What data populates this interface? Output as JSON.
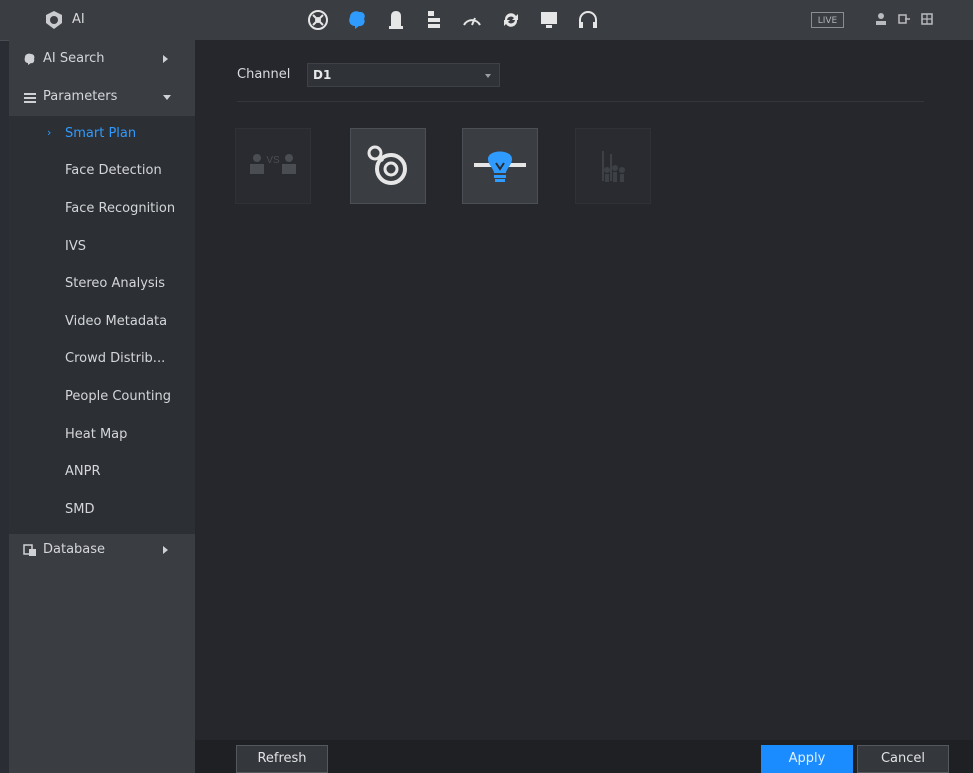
{
  "app": {
    "title": "AI"
  },
  "topbar": {
    "icons": [
      "ptz-icon",
      "ai-brain-icon",
      "alarm-bell-icon",
      "storage-icon",
      "performance-gauge-icon",
      "refresh-sync-icon",
      "monitor-icon",
      "headset-icon"
    ],
    "live_label": "LIVE",
    "right_icons": [
      "user-icon",
      "logout-icon",
      "grid-icon"
    ]
  },
  "sidebar": {
    "ai_search": "AI Search",
    "parameters": "Parameters",
    "items": [
      "Smart Plan",
      "Face Detection",
      "Face Recognition",
      "IVS",
      "Stereo Analysis",
      "Video Metadata",
      "Crowd Distrib...",
      "People Counting",
      "Heat Map",
      "ANPR",
      "SMD"
    ],
    "active_index": 0,
    "database": "Database"
  },
  "main": {
    "channel_label": "Channel",
    "channel_value": "D1",
    "plans": [
      {
        "name": "face-vs-icon",
        "enabled": false,
        "text": "VS"
      },
      {
        "name": "ivs-target-icon",
        "enabled": true
      },
      {
        "name": "smart-bulb-icon",
        "enabled": true,
        "color": "#2f9bff"
      },
      {
        "name": "people-counting-icon",
        "enabled": false
      }
    ]
  },
  "footer": {
    "refresh": "Refresh",
    "apply": "Apply",
    "cancel": "Cancel"
  },
  "colors": {
    "accent": "#1a8cff",
    "bg": "#25272c",
    "sidebar": "#3a3d42"
  }
}
